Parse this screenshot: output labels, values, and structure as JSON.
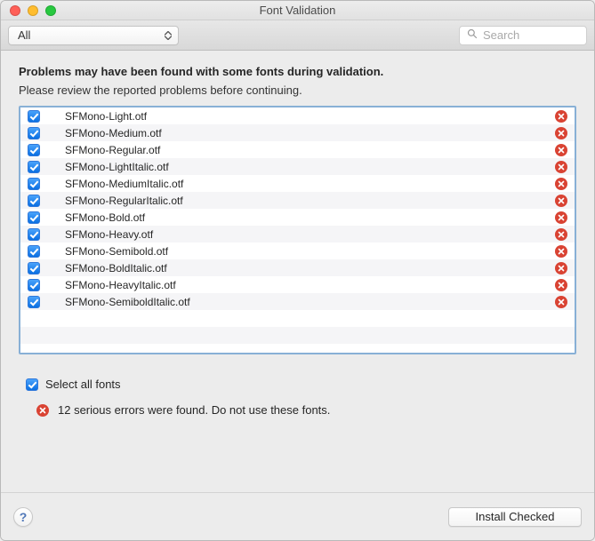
{
  "title": "Font Validation",
  "toolbar": {
    "filter_label": "All",
    "search_placeholder": "Search"
  },
  "heading": "Problems may have been found with some fonts during validation.",
  "subheading": "Please review the reported problems before continuing.",
  "fonts": [
    {
      "name": "SFMono-Light.otf",
      "checked": true,
      "error": true
    },
    {
      "name": "SFMono-Medium.otf",
      "checked": true,
      "error": true
    },
    {
      "name": "SFMono-Regular.otf",
      "checked": true,
      "error": true
    },
    {
      "name": "SFMono-LightItalic.otf",
      "checked": true,
      "error": true
    },
    {
      "name": "SFMono-MediumItalic.otf",
      "checked": true,
      "error": true
    },
    {
      "name": "SFMono-RegularItalic.otf",
      "checked": true,
      "error": true
    },
    {
      "name": "SFMono-Bold.otf",
      "checked": true,
      "error": true
    },
    {
      "name": "SFMono-Heavy.otf",
      "checked": true,
      "error": true
    },
    {
      "name": "SFMono-Semibold.otf",
      "checked": true,
      "error": true
    },
    {
      "name": "SFMono-BoldItalic.otf",
      "checked": true,
      "error": true
    },
    {
      "name": "SFMono-HeavyItalic.otf",
      "checked": true,
      "error": true
    },
    {
      "name": "SFMono-SemiboldItalic.otf",
      "checked": true,
      "error": true
    }
  ],
  "select_all": {
    "label": "Select all fonts",
    "checked": true
  },
  "error_summary": {
    "count_text": "12 serious errors were found. ",
    "warning_text": "Do not use these fonts."
  },
  "buttons": {
    "help": "?",
    "install": "Install Checked"
  }
}
